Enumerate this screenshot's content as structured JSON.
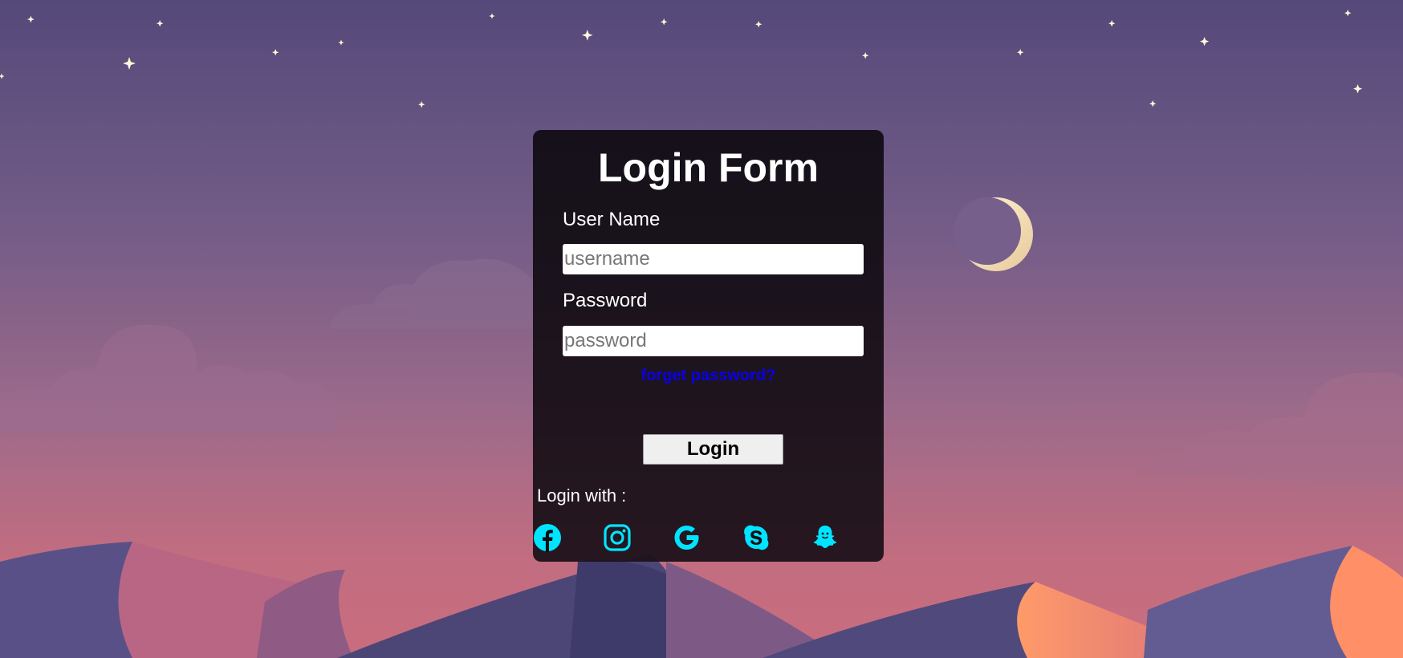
{
  "form": {
    "title": "Login Form",
    "username_label": "User Name",
    "username_placeholder": "username",
    "username_value": "",
    "password_label": "Password",
    "password_placeholder": "password",
    "password_value": "",
    "forgot_link": "forget password?",
    "login_button": "Login",
    "login_with_label": "Login with :"
  },
  "social": [
    {
      "icon": "facebook-icon"
    },
    {
      "icon": "instagram-icon"
    },
    {
      "icon": "google-icon"
    },
    {
      "icon": "skype-icon"
    },
    {
      "icon": "snapchat-icon"
    }
  ],
  "colors": {
    "sky_top": "#54497a",
    "sky_bottom": "#c96d80",
    "social_icon": "#00e5ff",
    "link": "#0b00e6",
    "moon": "#f3e3b8"
  }
}
